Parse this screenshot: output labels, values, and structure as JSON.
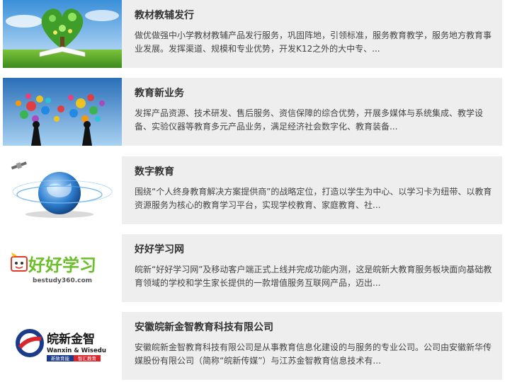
{
  "items": [
    {
      "title": "教材教辅发行",
      "desc": "做优做强中小学教材教辅产品发行服务，巩固阵地，引领标准，服务教育教学，服务地方教育事业发展。发挥渠道、规模和专业优势，开发K12之外的大中专、...",
      "thumb_icon": "heart-tree-book-image"
    },
    {
      "title": "教育新业务",
      "desc": "发挥产品资源、技术研发、售后服务、资信保障的综合优势，开展多媒体与系统集成、教学设备、实验仪器等教育多元产品业务，满足经济社会数字化、教育装备...",
      "thumb_icon": "colorful-bubbles-image"
    },
    {
      "title": "数字教育",
      "desc": "围绕“个人终身教育解决方案提供商”的战略定位，打造以学生为中心、以学习卡为纽带、以教育资源服务为核心的教育学习平台，实现学校教育、家庭教育、社...",
      "thumb_icon": "globe-satellite-image"
    },
    {
      "title": "好好学习网",
      "desc": "皖新“好好学习网”及移动客户端正式上线并完成功能内测，这是皖新大教育服务板块面向基础教育领域的学校和学生家长提供的一款增值服务互联网产品，迈出...",
      "thumb_icon": "haohaoxuexi-logo",
      "logo_text": "好好学习",
      "logo_url": "bestudy360.com"
    },
    {
      "title": "安徽皖新金智教育科技有限公司",
      "desc": "安徽皖新金智教育科技有限公司是从事教育信息化建设的与服务的专业公司。公司由安徽新华传媒股份有限公司（简称“皖新传媒”）与江苏金智教育信息技术有...",
      "thumb_icon": "wanxin-wisedu-logo",
      "logo_cn": "皖新金智",
      "logo_en": "Wanxin & Wisedu",
      "logo_tag1": "新致育能",
      "logo_tag2": "智汇教育"
    }
  ]
}
